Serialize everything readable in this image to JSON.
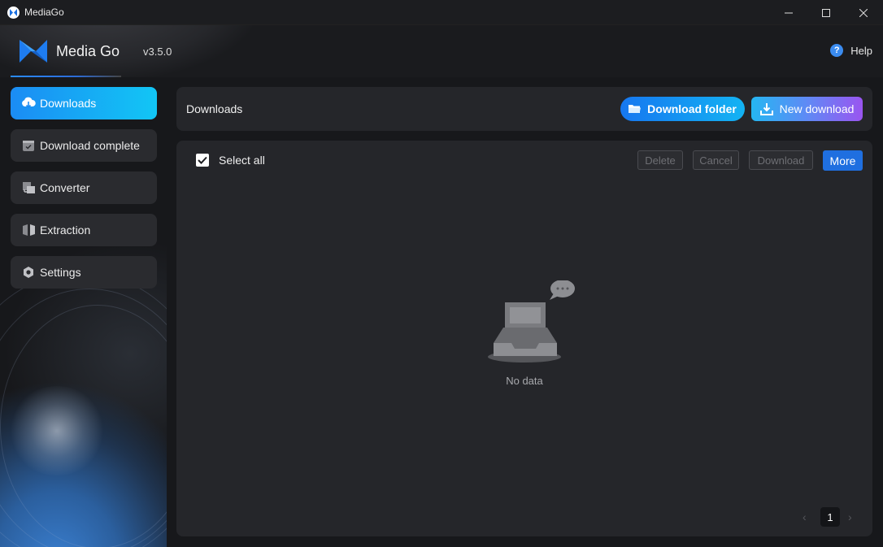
{
  "window": {
    "title": "MediaGo"
  },
  "header": {
    "brand": "Media Go",
    "version": "v3.5.0",
    "help": "Help"
  },
  "sidebar": {
    "items": [
      {
        "label": "Downloads",
        "icon": "cloud-download-icon",
        "active": true
      },
      {
        "label": "Download complete",
        "icon": "check-box-icon",
        "active": false
      },
      {
        "label": "Converter",
        "icon": "converter-icon",
        "active": false
      },
      {
        "label": "Extraction",
        "icon": "extraction-icon",
        "active": false
      },
      {
        "label": "Settings",
        "icon": "gear-icon",
        "active": false
      }
    ]
  },
  "toolbar": {
    "title": "Downloads",
    "download_folder": "Download folder",
    "new_download": "New download"
  },
  "list": {
    "select_all": "Select all",
    "actions": {
      "delete": "Delete",
      "cancel": "Cancel",
      "download": "Download",
      "more": "More"
    },
    "empty_text": "No data"
  },
  "pagination": {
    "current_page": "1"
  },
  "colors": {
    "accent": "#1b8cf4",
    "active_nav_start": "#1b8cf4",
    "active_nav_end": "#12c6f5",
    "more_button": "#1f6fe0",
    "background": "#17181b",
    "panel": "#25262a"
  }
}
